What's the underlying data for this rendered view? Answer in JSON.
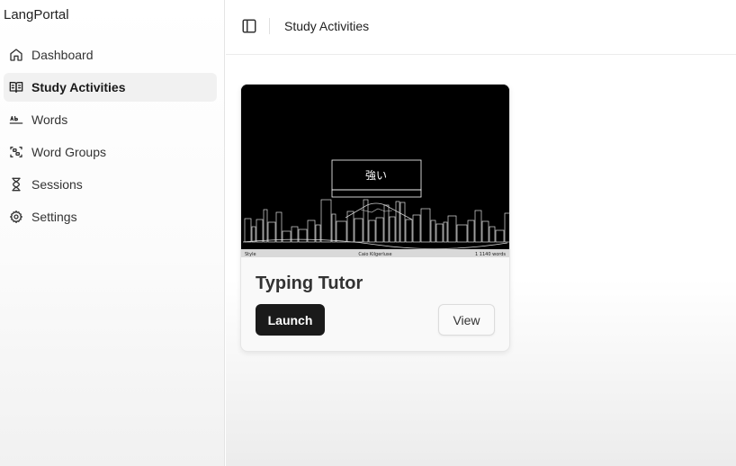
{
  "app": {
    "brand": "LangPortal"
  },
  "sidebar": {
    "items": [
      {
        "label": "Dashboard",
        "icon": "home-icon",
        "active": false
      },
      {
        "label": "Study Activities",
        "icon": "book-open-icon",
        "active": true
      },
      {
        "label": "Words",
        "icon": "spell-check-icon",
        "active": false
      },
      {
        "label": "Word Groups",
        "icon": "group-icon",
        "active": false
      },
      {
        "label": "Sessions",
        "icon": "hourglass-icon",
        "active": false
      },
      {
        "label": "Settings",
        "icon": "gear-icon",
        "active": false
      }
    ]
  },
  "header": {
    "title": "Study Activities",
    "toggle_icon": "sidebar-toggle-icon"
  },
  "activities": [
    {
      "title": "Typing Tutor",
      "launch_label": "Launch",
      "view_label": "View",
      "preview": {
        "kanji": "強い",
        "status_left": "Style",
        "status_center": "Caio Kilgerluse",
        "status_right": "1 1140 words"
      }
    }
  ],
  "colors": {
    "accent": "#1a1a1a",
    "sidebar_active_bg": "#f1f1f1",
    "preview_bg": "#000000"
  }
}
